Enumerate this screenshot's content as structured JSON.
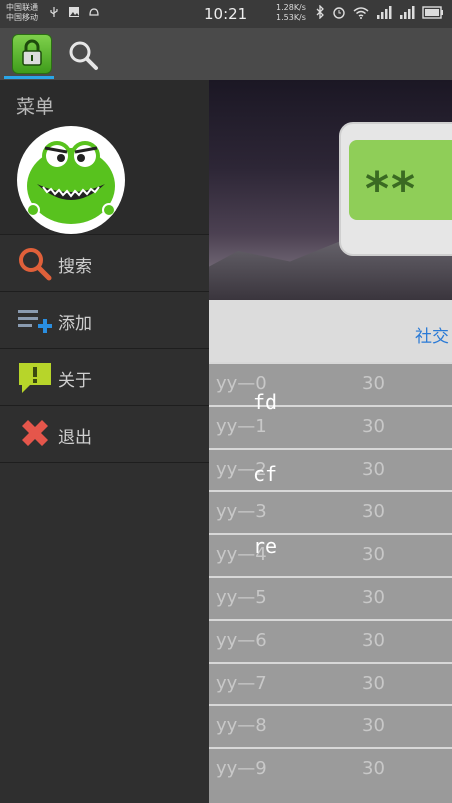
{
  "statusbar": {
    "carrier1": "中国联通",
    "carrier2": "中国移动",
    "time": "10:21",
    "speed_up": "1.28K/s",
    "speed_down": "1.53K/s"
  },
  "drawer": {
    "title": "菜单",
    "items": [
      {
        "label": "搜索",
        "icon": "search-icon"
      },
      {
        "label": "添加",
        "icon": "add-list-icon"
      },
      {
        "label": "关于",
        "icon": "info-icon"
      },
      {
        "label": "退出",
        "icon": "exit-icon"
      }
    ]
  },
  "content": {
    "card_text": "**",
    "tab_label": "社交",
    "rows": [
      {
        "name": "yy—0",
        "value": "30"
      },
      {
        "name": "yy—1",
        "value": "30"
      },
      {
        "name": "yy—2",
        "value": "30"
      },
      {
        "name": "yy—3",
        "value": "30"
      },
      {
        "name": "yy—4",
        "value": "30"
      },
      {
        "name": "yy—5",
        "value": "30"
      },
      {
        "name": "yy—6",
        "value": "30"
      },
      {
        "name": "yy—7",
        "value": "30"
      },
      {
        "name": "yy—8",
        "value": "30"
      },
      {
        "name": "yy—9",
        "value": "30"
      }
    ],
    "overlay_texts": [
      "fd",
      "cf",
      "re"
    ]
  },
  "colors": {
    "accent": "#2aa6e8",
    "tab_text": "#2a7ad6",
    "app_green": "#5fb832"
  }
}
